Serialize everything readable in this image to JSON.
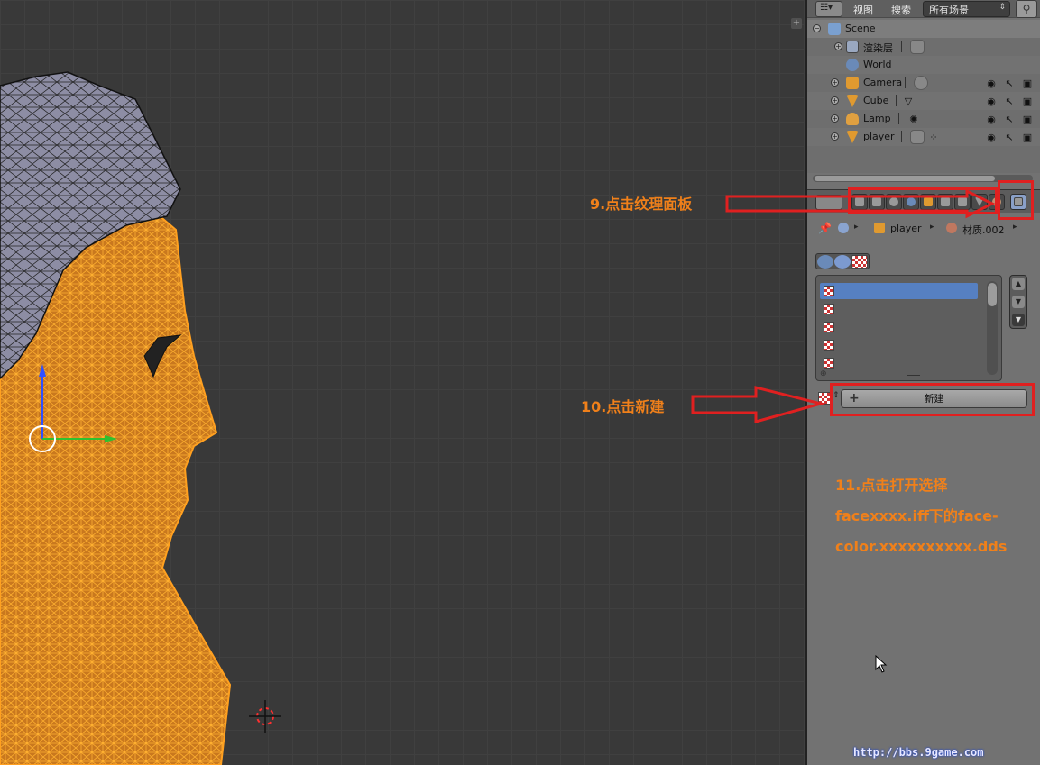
{
  "outliner": {
    "menu_view": "视图",
    "menu_search": "搜索",
    "scene_select": "所有场景",
    "rows": [
      {
        "label": "Scene"
      },
      {
        "label": "渲染层"
      },
      {
        "label": "World"
      },
      {
        "label": "Camera"
      },
      {
        "label": "Cube"
      },
      {
        "label": "Lamp"
      },
      {
        "label": "player"
      }
    ]
  },
  "properties": {
    "breadcrumb_object": "player",
    "breadcrumb_material": "材质.002",
    "new_button_label": "新建"
  },
  "annotations": {
    "step9": "9.点击纹理面板",
    "step10": "10.点击新建",
    "step11_line1": "11.点击打开选择",
    "step11_line2": "facexxxx.iff下的face-",
    "step11_line3": "color.xxxxxxxxxx.dds"
  },
  "watermark": "http://bbs.9game.com",
  "colors": {
    "annotation_orange": "#f0801a",
    "annotation_red": "#e02020",
    "active_slot_blue": "#5680c2",
    "mesh_orange": "#f5a020"
  },
  "icons": {
    "visibility": "eye-icon",
    "selectability": "cursor-icon",
    "renderability": "camera-icon"
  }
}
